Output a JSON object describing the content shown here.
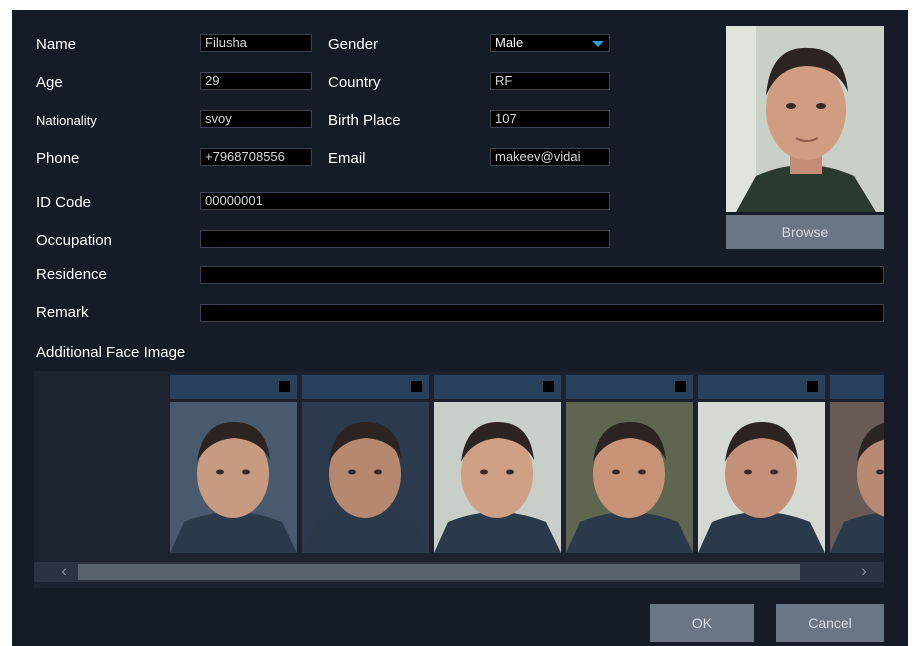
{
  "form": {
    "name_label": "Name",
    "name_value": "Filusha",
    "gender_label": "Gender",
    "gender_value": "Male",
    "age_label": "Age",
    "age_value": "29",
    "country_label": "Country",
    "country_value": "RF",
    "nationality_label": "Nationality",
    "nationality_value": "svoy",
    "birthplace_label": "Birth Place",
    "birthplace_value": "107",
    "phone_label": "Phone",
    "phone_value": "+7968708556",
    "email_label": "Email",
    "email_value": "makeev@vidai",
    "idcode_label": "ID Code",
    "idcode_value": "00000001",
    "occupation_label": "Occupation",
    "occupation_value": "",
    "residence_label": "Residence",
    "residence_value": "",
    "remark_label": "Remark",
    "remark_value": ""
  },
  "photo": {
    "browse_label": "Browse"
  },
  "additional": {
    "title": "Additional Face Image",
    "thumbnails": [
      {
        "bg": "#4a5a6e",
        "face": "#c79a82"
      },
      {
        "bg": "#2c3a4e",
        "face": "#b78870"
      },
      {
        "bg": "#c8cfc8",
        "face": "#cf9f86"
      },
      {
        "bg": "#5e6650",
        "face": "#c99377"
      },
      {
        "bg": "#d4d9d2",
        "face": "#c4907a"
      },
      {
        "bg": "#6a5a55",
        "face": "#b88a74"
      }
    ]
  },
  "buttons": {
    "ok_label": "OK",
    "cancel_label": "Cancel"
  },
  "colors": {
    "background": "#151b27",
    "field": "#000000",
    "button": "#6b7685",
    "accent": "#2a9fd6",
    "thumb_header": "#29405c"
  }
}
